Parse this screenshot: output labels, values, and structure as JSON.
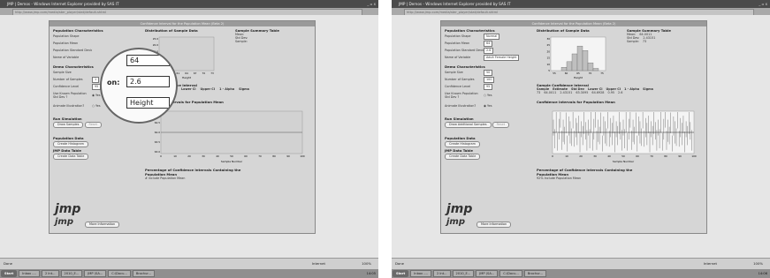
{
  "window": {
    "title": "JMP | Demos - Windows Internet Explorer provided by SAS IT",
    "url": "http://www.jmp.com/media/ster_player/stat/default.shtml",
    "buttons": [
      "_",
      "▫",
      "x"
    ]
  },
  "app": {
    "title": "Confidence Interval for the Population Mean (Beta 2)"
  },
  "left": {
    "pop_char": {
      "header": "Population Characteristics",
      "labels": [
        "Population Shape",
        "Population Mean",
        "Population Standard Deviation",
        "Name of Variable"
      ]
    },
    "magnifier": {
      "mean": "64",
      "sd": "2.6",
      "sd_suffix": "on:",
      "variable": "Height"
    },
    "dist_header": "Distribution of Sample Data",
    "summary": {
      "header": "Sample Summary Table",
      "labels": [
        "Mean:",
        "Std Dev:",
        "Sample:"
      ]
    },
    "demo": {
      "header": "Demo Characteristics",
      "labels": [
        "Sample Size",
        "Number of Samples",
        "Confidence Level",
        "Use Known Population Std Dev ?",
        "Animate Illustration?"
      ],
      "samples": "1",
      "conf": "95",
      "yes": "Yes",
      "no": "No"
    },
    "ci_header": "Sample Confidence Interval",
    "ci_cols": [
      "Sample",
      "Estimate",
      "Lower CI",
      "Upper CI",
      "1 - Alpha",
      "Sigma"
    ],
    "cip_header": "Confidence Intervals for Population Mean",
    "run_header": "Run Simulation",
    "draw_btn": "Draw Samples",
    "reset_btn": "Reset",
    "pop_data": "Population Data",
    "create_hist": "Create Histogram",
    "jmp_table": "JMP Data Table",
    "create_table": "Create Data Table",
    "pct_header": "Percentage of Confidence Intervals Containing the Population Mean",
    "pct_text": "# include Population Mean",
    "more_info": "More Information",
    "logo": "jmp",
    "hist_xlabel": "Height",
    "hist_xticks": [
      "55",
      "58",
      "61",
      "64",
      "67",
      "70",
      "73"
    ],
    "hist_yticks": [
      "25.0",
      "20.0",
      "15.0",
      "10.0",
      "5.0",
      "0.0"
    ],
    "cip_yticks": [
      "65.0",
      "64.5",
      "64.0",
      "63.5",
      "63.0"
    ],
    "cip_xticks": [
      "0",
      "10",
      "20",
      "30",
      "40",
      "50",
      "60",
      "70",
      "80",
      "90",
      "100"
    ],
    "cip_xlabel": "Sample Number"
  },
  "right": {
    "pop_char": {
      "header": "Population Characteristics",
      "labels": [
        "Population Shape",
        "Population Mean",
        "Population Standard Deviation",
        "Name of Variable"
      ],
      "values": [
        "Normal",
        "64",
        "2.6",
        "Adult Female Height"
      ]
    },
    "dist_header": "Distribution of Sample Data",
    "summary": {
      "header": "Sample Summary Table",
      "labels": [
        "Mean:",
        "Std Dev:",
        "Sample:"
      ],
      "values": [
        "64.0011",
        "2.43151",
        "73"
      ]
    },
    "demo": {
      "header": "Demo Characteristics",
      "labels": [
        "Sample Size",
        "Number of Samples",
        "Confidence Level",
        "Use Known Population Std Dev ?",
        "Animate Illustration?"
      ],
      "size": "50",
      "samples": "100",
      "conf": "95",
      "yes": "Yes",
      "no": "No"
    },
    "ci_header": "Sample Confidence Interval",
    "ci_cols": [
      "Sample",
      "Estimate",
      "Std Dev",
      "Lower CI",
      "Upper CI",
      "1 - Alpha",
      "Sigma"
    ],
    "ci_vals": [
      "73",
      "64.0011",
      "2.43151",
      "63.3095",
      "64.6928",
      "0.95",
      "2.6"
    ],
    "cip_header": "Confidence Intervals for Population Mean",
    "run_header": "Run Simulation",
    "draw_btn": "Draw Additional Samples",
    "reset_btn": "Reset",
    "pop_data": "Population Data",
    "create_hist": "Create Histogram",
    "jmp_table": "JMP Data Table",
    "create_table": "Create Data Table",
    "pct_header": "Percentage of Confidence Intervals Containing the Population Mean",
    "pct_text": "92% Include Population Mean",
    "more_info": "More Information",
    "logo": "jmp",
    "hist_xlabel": "Height",
    "hist_xticks": [
      "55",
      "60",
      "65",
      "70",
      "75"
    ],
    "hist_yticks": [
      "30",
      "25",
      "20",
      "15",
      "10",
      "5"
    ],
    "cip_xticks": [
      "0",
      "10",
      "20",
      "30",
      "40",
      "50",
      "60",
      "70",
      "80",
      "90",
      "100"
    ],
    "cip_xlabel": "Sample Number"
  },
  "status": {
    "done": "Done",
    "zone": "Internet",
    "zoom": "100%"
  },
  "taskbar": {
    "start": "Start",
    "tasks_left": [
      "Inbox -...",
      "2 Int...",
      "2010_E...",
      "JMP (SA...",
      "C:\\Docu...",
      "Brochur..."
    ],
    "tasks_right": [
      "Inbox -...",
      "2 Int...",
      "2010_E...",
      "JMP (SA...",
      "C:\\Docu...",
      "Brochur..."
    ],
    "clock_left": "14:05",
    "clock_right": "14:06"
  },
  "chart_data": [
    {
      "type": "bar",
      "title": "Distribution of Sample Data",
      "xlabel": "Height",
      "categories": [
        "58",
        "60",
        "62",
        "64",
        "66",
        "68",
        "70"
      ],
      "values": [
        3,
        8,
        15,
        22,
        18,
        7,
        2
      ]
    },
    {
      "type": "line",
      "title": "Confidence Intervals for Population Mean",
      "xlabel": "Sample Number",
      "x_range": [
        0,
        100
      ],
      "series": [
        {
          "values": [
            64.3,
            63.6,
            64.7,
            63.4,
            64.2,
            64.8,
            63.5,
            64.1,
            63.8,
            64.6,
            63.3,
            64.4,
            64.0,
            63.7,
            64.9,
            63.6,
            64.3,
            63.9,
            64.5,
            63.4,
            64.2,
            63.8,
            64.6,
            64.1,
            63.5
          ]
        }
      ]
    }
  ]
}
